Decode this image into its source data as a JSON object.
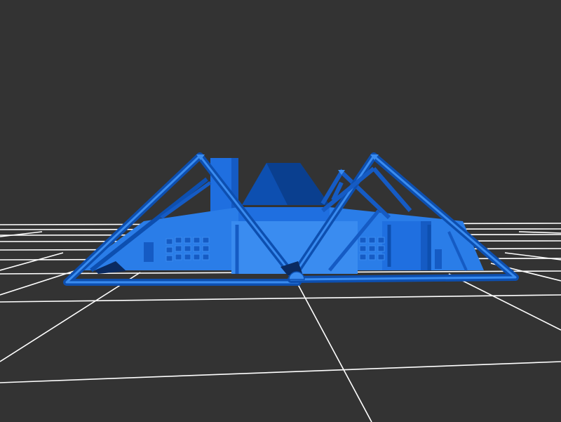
{
  "viewer": {
    "background_color": "#333333",
    "grid_color": "#ffffff",
    "model_color": "#1f6fe0",
    "model_shade_dark": "#0a3f8f",
    "model_shade_mid": "#155bc4",
    "model_shade_light": "#3a8cf0"
  }
}
